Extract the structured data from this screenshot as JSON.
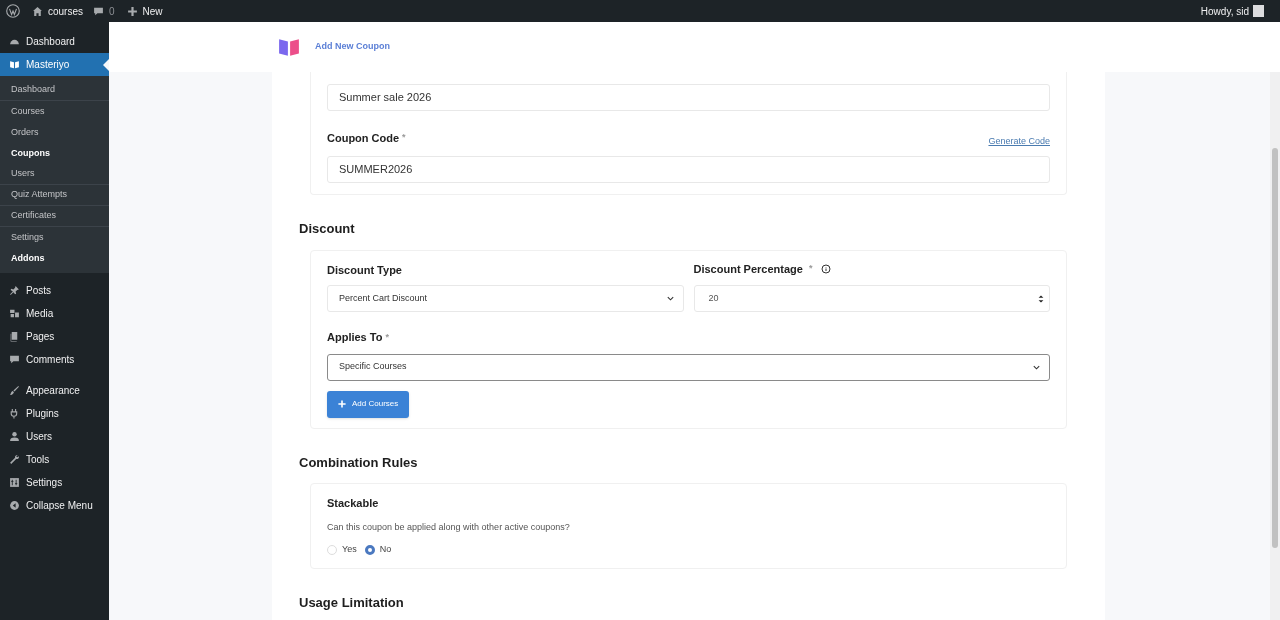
{
  "admin_bar": {
    "site": "courses",
    "comments": "0",
    "new": "New",
    "greeting": "Howdy, sid"
  },
  "sidebar": {
    "items": [
      {
        "label": "Dashboard",
        "selected": false
      },
      {
        "label": "Masteriyo",
        "selected": true,
        "children": [
          {
            "label": "Dashboard",
            "current": false,
            "divider": true
          },
          {
            "label": "Courses",
            "current": false,
            "divider": false
          },
          {
            "label": "Orders",
            "current": false,
            "divider": false
          },
          {
            "label": "Coupons",
            "current": true,
            "divider": false
          },
          {
            "label": "Users",
            "current": false,
            "divider": true
          },
          {
            "label": "Quiz Attempts",
            "current": false,
            "divider": true
          },
          {
            "label": "Certificates",
            "current": false,
            "divider": true
          },
          {
            "label": "Settings",
            "current": false,
            "divider": false
          },
          {
            "label": "Addons",
            "current": true,
            "divider": false
          }
        ]
      },
      {
        "label": "Posts",
        "selected": false
      },
      {
        "label": "Media",
        "selected": false
      },
      {
        "label": "Pages",
        "selected": false
      },
      {
        "label": "Comments",
        "selected": false
      },
      {
        "label": "Appearance",
        "selected": false
      },
      {
        "label": "Plugins",
        "selected": false
      },
      {
        "label": "Users",
        "selected": false
      },
      {
        "label": "Tools",
        "selected": false
      },
      {
        "label": "Settings",
        "selected": false
      },
      {
        "label": "Collapse Menu",
        "selected": false
      }
    ]
  },
  "header": {
    "title": "Add New Coupon"
  },
  "coupon": {
    "description_value": "Summer sale 2026",
    "code_label": "Coupon Code",
    "code_required_mark": "*",
    "generate_link": "Generate Code",
    "code_value": "SUMMER2026"
  },
  "discount": {
    "heading": "Discount",
    "type_label": "Discount Type",
    "type_value": "Percent Cart Discount",
    "percentage_label": "Discount Percentage",
    "percentage_required_mark": "*",
    "percentage_value": "20",
    "applies_label": "Applies To",
    "applies_required_mark": "*",
    "applies_value": "Specific Courses",
    "add_button": "Add Courses"
  },
  "combination": {
    "heading": "Combination Rules",
    "stackable_label": "Stackable",
    "question": "Can this coupon be applied along with other active coupons?",
    "options": [
      {
        "label": "Yes",
        "selected": false
      },
      {
        "label": "No",
        "selected": true
      }
    ]
  },
  "usage": {
    "heading": "Usage Limitation"
  }
}
